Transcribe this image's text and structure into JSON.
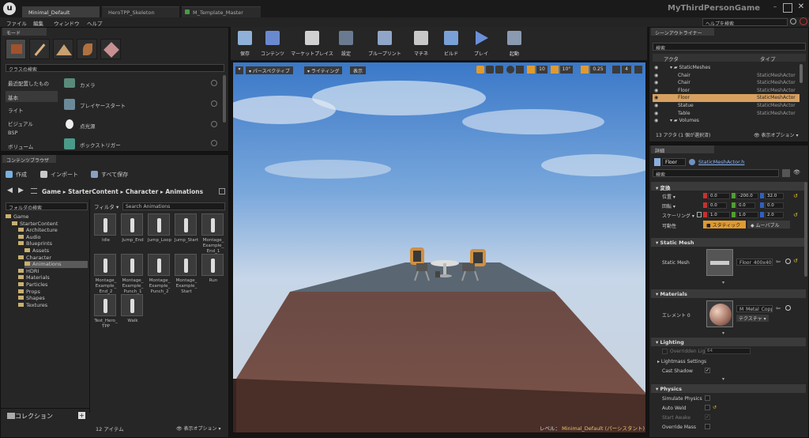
{
  "window": {
    "tabs": [
      {
        "label": "Minimal_Default"
      },
      {
        "label": "HeroTPP_Skeleton"
      },
      {
        "label": "M_Template_Master"
      }
    ],
    "project_title": "MyThirdPersonGame",
    "help_search_placeholder": "ヘルプを検索"
  },
  "menu": [
    "ファイル",
    "編集",
    "ウィンドウ",
    "ヘルプ"
  ],
  "modes": {
    "tab_label": "モード",
    "search_placeholder": "クラスの検索",
    "categories": [
      "最近配置したもの",
      "基本",
      "ライト",
      "ビジュアル",
      "BSP",
      "ボリューム"
    ],
    "items": [
      "カメラ",
      "プレイヤースタート",
      "点光源",
      "ボックストリガー"
    ]
  },
  "toolbar": {
    "buttons": [
      "保存",
      "コンテンツ",
      "マーケットプレイス",
      "設定",
      "ブループリント",
      "マチネ",
      "ビルド",
      "プレイ",
      "起動"
    ]
  },
  "viewport": {
    "perspective_label": "パースペクティブ",
    "lighting_label": "ライティング",
    "show_label": "表示",
    "grid_snap": "10",
    "rot_snap": "10°",
    "scale_snap": "0.25",
    "cam_speed": "4",
    "level_label": "レベル：",
    "level_name": "Minimal_Default (パーシスタント)"
  },
  "content_browser": {
    "tab_label": "コンテンツブラウザ",
    "create_label": "作成",
    "import_label": "インポート",
    "save_all_label": "すべて保存",
    "breadcrumb": [
      "Game",
      "StarterContent",
      "Character",
      "Animations"
    ],
    "folder_search_placeholder": "フォルダの検索",
    "filter_label": "フィルタ",
    "asset_search_placeholder": "Search Animations",
    "tree": [
      {
        "label": "Game",
        "level": 0
      },
      {
        "label": "StarterContent",
        "level": 1
      },
      {
        "label": "Architecture",
        "level": 2
      },
      {
        "label": "Audio",
        "level": 2
      },
      {
        "label": "Blueprints",
        "level": 2
      },
      {
        "label": "Assets",
        "level": 3
      },
      {
        "label": "Character",
        "level": 2
      },
      {
        "label": "Animations",
        "level": 3
      },
      {
        "label": "HDRI",
        "level": 2
      },
      {
        "label": "Materials",
        "level": 2
      },
      {
        "label": "Particles",
        "level": 2
      },
      {
        "label": "Props",
        "level": 2
      },
      {
        "label": "Shapes",
        "level": 2
      },
      {
        "label": "Textures",
        "level": 2
      }
    ],
    "assets": [
      "Idle",
      "Jump_End",
      "Jump_Loop",
      "Jump_Start",
      "Montage_Example_End_1",
      "Montage_Example_End_2",
      "Montage_Example_Punch_1",
      "Montage_Example_Punch_2",
      "Montage_Example_Start",
      "Run",
      "Test_Hero_TPP",
      "Walk"
    ],
    "collections_label": "コレクション",
    "item_count": "12 アイテム",
    "view_options": "表示オプション"
  },
  "outliner": {
    "tab_label": "シーンアウトライナー",
    "search_placeholder": "検索",
    "col_actor": "アクタ",
    "col_type": "タイプ",
    "rows": [
      {
        "name": "StaticMeshes",
        "type": "",
        "folder": true
      },
      {
        "name": "Chair",
        "type": "StaticMeshActor"
      },
      {
        "name": "Chair",
        "type": "StaticMeshActor"
      },
      {
        "name": "Floor",
        "type": "StaticMeshActor"
      },
      {
        "name": "Floor",
        "type": "StaticMeshActor",
        "selected": true
      },
      {
        "name": "Statue",
        "type": "StaticMeshActor"
      },
      {
        "name": "Table",
        "type": "StaticMeshActor"
      },
      {
        "name": "Volumes",
        "type": "",
        "folder": true
      }
    ],
    "count": "13 アクタ (1 個が選択済)",
    "view_options": "表示オプション"
  },
  "details": {
    "tab_label": "詳細",
    "actor_name": "Floor",
    "actor_class": "StaticMeshActor.h",
    "search_placeholder": "検索",
    "transform": {
      "header": "変換",
      "location_label": "位置",
      "rotation_label": "回転",
      "scale_label": "スケーリング",
      "mobility_label": "可動性",
      "location": [
        "0.0",
        "-200.0",
        "32.0"
      ],
      "rotation": [
        "0.0",
        "0.0",
        "0.0"
      ],
      "scale": [
        "1.0",
        "1.0",
        "2.0"
      ],
      "static_label": "スタティック",
      "movable_label": "ムーバブル"
    },
    "static_mesh": {
      "header": "Static Mesh",
      "label": "Static Mesh",
      "value": "Floor_400x400"
    },
    "materials": {
      "header": "Materials",
      "element_label": "エレメント 0",
      "value": "M_Metal_Copper",
      "texture_label": "テクスチャ"
    },
    "lighting": {
      "header": "Lighting",
      "overridden_label": "Overridden Ligh",
      "overridden_value": "64",
      "lightmass_label": "Lightmass Settings",
      "cast_shadow_label": "Cast Shadow"
    },
    "physics": {
      "header": "Physics",
      "simulate_label": "Simulate Physics",
      "auto_weld_label": "Auto Weld",
      "start_awake_label": "Start Awake",
      "override_mass_label": "Override Mass"
    }
  },
  "colors": {
    "accent": "#f0a030",
    "selected": "#d8a060",
    "x": "#c83030",
    "y": "#50a030",
    "z": "#3060c0"
  }
}
